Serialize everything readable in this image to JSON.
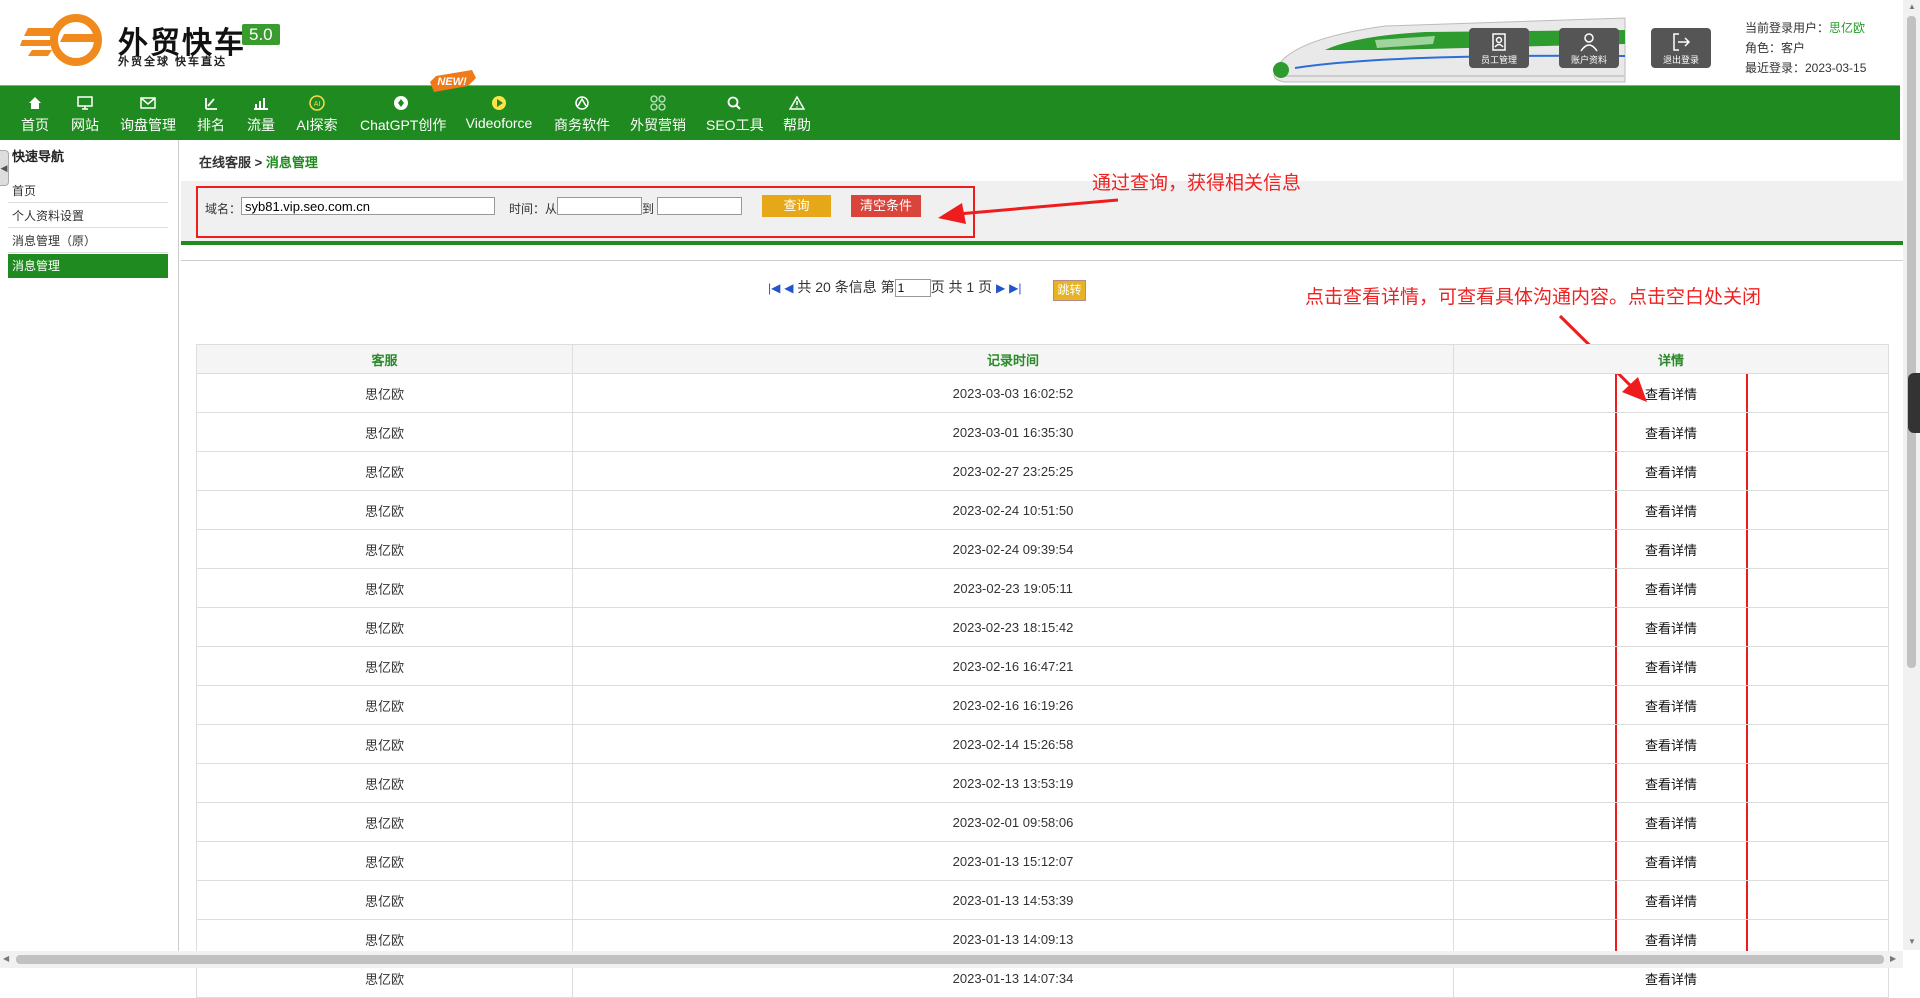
{
  "header": {
    "brand": "外贸快车",
    "version": "5.0",
    "slogan": "外贸全球 快车直达",
    "buttons": [
      {
        "label": "员工管理",
        "icon": "staff-icon"
      },
      {
        "label": "账户资料",
        "icon": "account-icon"
      },
      {
        "label": "退出登录",
        "icon": "logout-icon"
      }
    ],
    "user_label": "当前登录用户：",
    "user_name": "思亿欧",
    "role": "角色：客户",
    "last_login": "最近登录：2023-03-15"
  },
  "nav": {
    "items": [
      {
        "label": "首页",
        "icon": "home-icon"
      },
      {
        "label": "网站",
        "icon": "monitor-icon"
      },
      {
        "label": "询盘管理",
        "icon": "mail-icon"
      },
      {
        "label": "排名",
        "icon": "rank-icon"
      },
      {
        "label": "流量",
        "icon": "bar-chart-icon"
      },
      {
        "label": "AI探索",
        "icon": "ai-icon"
      },
      {
        "label": "ChatGPT创作",
        "icon": "chatgpt-icon"
      },
      {
        "label": "Videoforce",
        "icon": "play-icon"
      },
      {
        "label": "商务软件",
        "icon": "software-icon"
      },
      {
        "label": "外贸营销",
        "icon": "marketing-icon"
      },
      {
        "label": "SEO工具",
        "icon": "search-icon"
      },
      {
        "label": "帮助",
        "icon": "warning-icon"
      }
    ],
    "new_badge": "NEW!"
  },
  "sidebar": {
    "title": "快速导航",
    "items": [
      "首页",
      "个人资料设置",
      "消息管理（原）",
      "消息管理"
    ],
    "active_index": 3
  },
  "breadcrumb": {
    "parent": "在线客服",
    "sep": ">",
    "current": "消息管理"
  },
  "filter": {
    "domain_label": "域名：",
    "domain_value": "syb81.vip.seo.com.cn",
    "time_label": "时间：从",
    "to_label": "到",
    "from_value": "",
    "to_value": "",
    "query_label": "查询",
    "clear_label": "清空条件"
  },
  "annotations": {
    "query_note": "通过查询，获得相关信息",
    "detail_note": "点击查看详情，可查看具体沟通内容。点击空白处关闭"
  },
  "pager": {
    "first": "|◀",
    "prev": "◀",
    "total_text": "共 20 条信息 第",
    "page_value": "1",
    "page_suffix": "页 共 1 页",
    "next": "▶",
    "last": "▶|",
    "jump_label": "跳转"
  },
  "table": {
    "headers": [
      "客服",
      "记录时间",
      "详情"
    ],
    "rows": [
      {
        "agent": "思亿欧",
        "time": "2023-03-03 16:02:52",
        "action": "查看详情"
      },
      {
        "agent": "思亿欧",
        "time": "2023-03-01 16:35:30",
        "action": "查看详情"
      },
      {
        "agent": "思亿欧",
        "time": "2023-02-27 23:25:25",
        "action": "查看详情"
      },
      {
        "agent": "思亿欧",
        "time": "2023-02-24 10:51:50",
        "action": "查看详情"
      },
      {
        "agent": "思亿欧",
        "time": "2023-02-24 09:39:54",
        "action": "查看详情"
      },
      {
        "agent": "思亿欧",
        "time": "2023-02-23 19:05:11",
        "action": "查看详情"
      },
      {
        "agent": "思亿欧",
        "time": "2023-02-23 18:15:42",
        "action": "查看详情"
      },
      {
        "agent": "思亿欧",
        "time": "2023-02-16 16:47:21",
        "action": "查看详情"
      },
      {
        "agent": "思亿欧",
        "time": "2023-02-16 16:19:26",
        "action": "查看详情"
      },
      {
        "agent": "思亿欧",
        "time": "2023-02-14 15:26:58",
        "action": "查看详情"
      },
      {
        "agent": "思亿欧",
        "time": "2023-02-13 13:53:19",
        "action": "查看详情"
      },
      {
        "agent": "思亿欧",
        "time": "2023-02-01 09:58:06",
        "action": "查看详情"
      },
      {
        "agent": "思亿欧",
        "time": "2023-01-13 15:12:07",
        "action": "查看详情"
      },
      {
        "agent": "思亿欧",
        "time": "2023-01-13 14:53:39",
        "action": "查看详情"
      },
      {
        "agent": "思亿欧",
        "time": "2023-01-13 14:09:13",
        "action": "查看详情"
      },
      {
        "agent": "思亿欧",
        "time": "2023-01-13 14:07:34",
        "action": "查看详情"
      }
    ]
  },
  "colors": {
    "nav_green": "#1f8a1f",
    "annotation_red": "#ee1c1c",
    "query_button": "#e6a818",
    "clear_button": "#d9453a"
  }
}
